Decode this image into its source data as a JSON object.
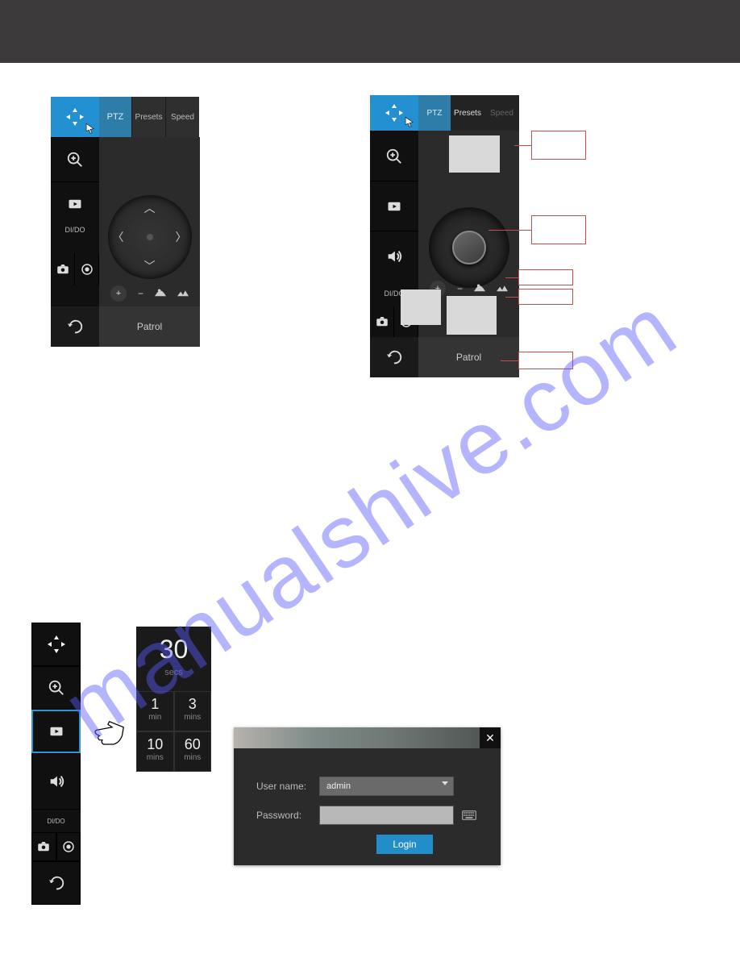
{
  "watermark": "manualshive.com",
  "panelA": {
    "tabs": {
      "ptz": "PTZ",
      "presets": "Presets",
      "speed": "Speed"
    },
    "side": {
      "dido": "DI/DO"
    },
    "patrol": "Patrol"
  },
  "panelB": {
    "tabs": {
      "ptz": "PTZ",
      "presets": "Presets",
      "speed": "Speed"
    },
    "side": {
      "dido": "DI/DO"
    },
    "patrol": "Patrol"
  },
  "panelC": {
    "dido": "DI/DO"
  },
  "panelD": {
    "top": {
      "value": "30",
      "unit": "secs"
    },
    "cells": [
      {
        "n": "1",
        "u": "min"
      },
      {
        "n": "3",
        "u": "mins"
      },
      {
        "n": "10",
        "u": "mins"
      },
      {
        "n": "60",
        "u": "mins"
      }
    ]
  },
  "login": {
    "userLabel": "User name:",
    "user": "admin",
    "passLabel": "Password:",
    "button": "Login"
  }
}
